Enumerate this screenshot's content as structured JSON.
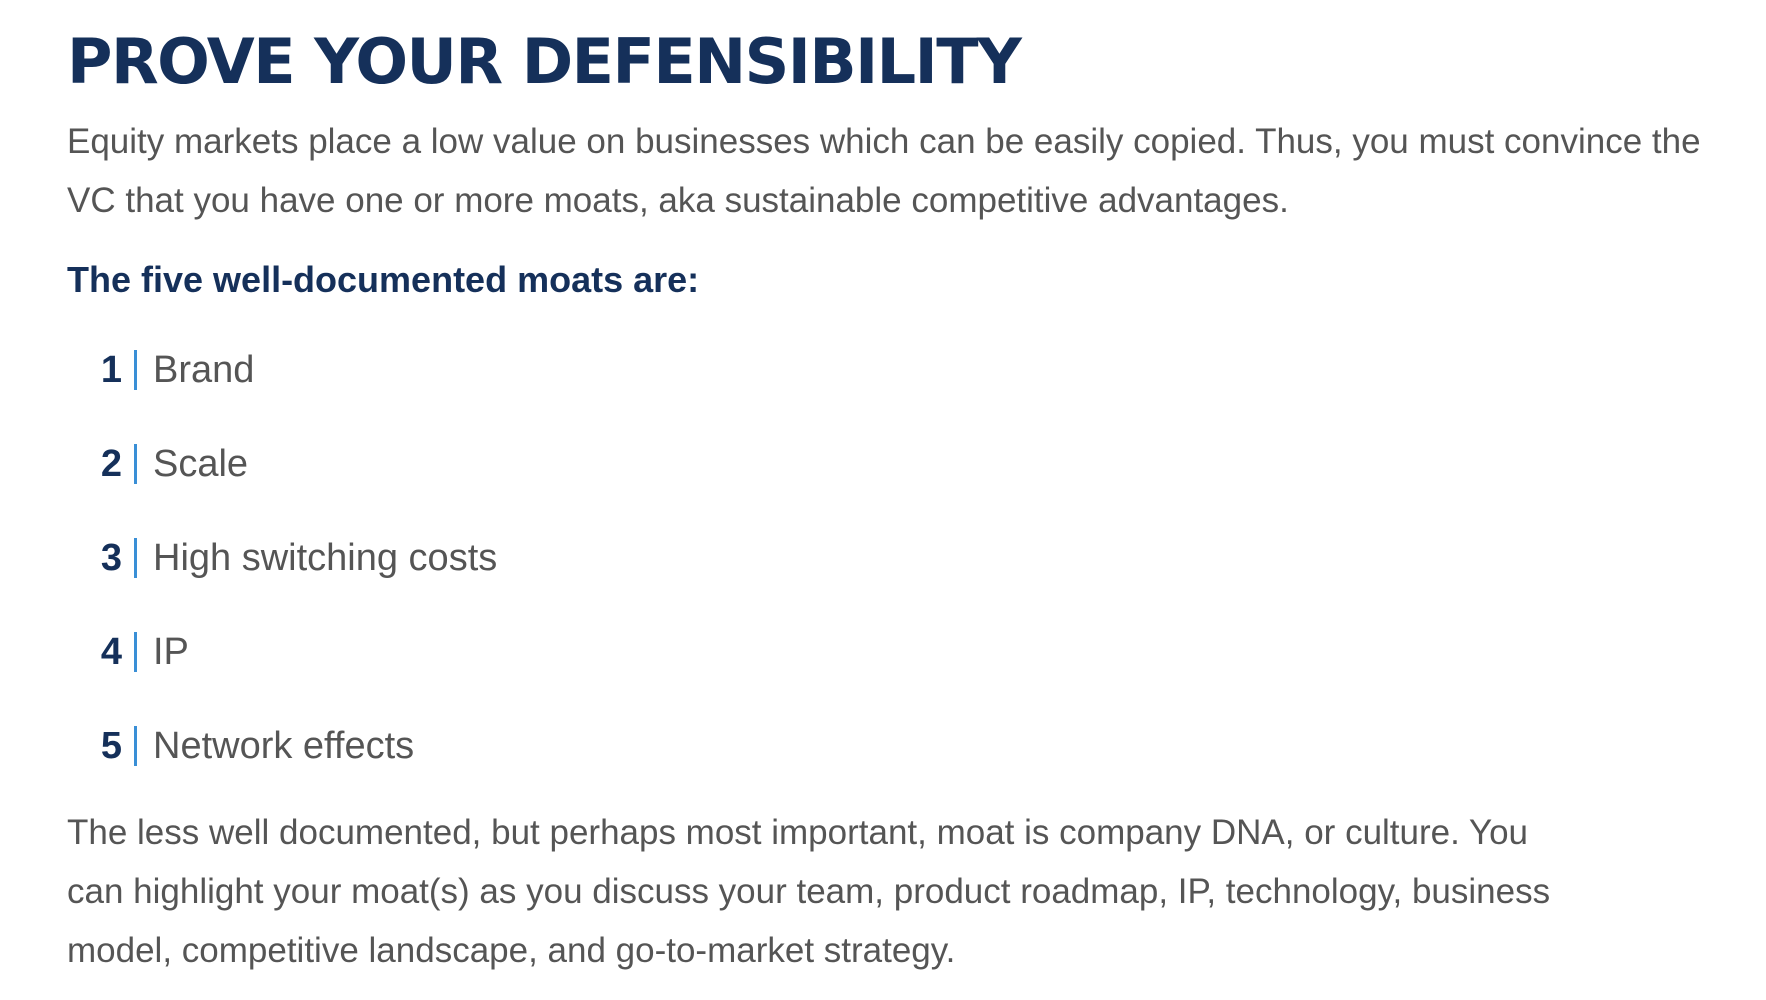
{
  "title": "PROVE YOUR DEFENSIBILITY",
  "intro": "Equity markets place a low value on businesses which can be easily copied. Thus, you must convince the VC that you have one or more moats, aka sustainable competitive advantages.",
  "subheading": "The five well-documented moats are:",
  "moats": [
    {
      "number": "1",
      "label": "Brand"
    },
    {
      "number": "2",
      "label": "Scale"
    },
    {
      "number": "3",
      "label": "High switching costs"
    },
    {
      "number": "4",
      "label": "IP"
    },
    {
      "number": "5",
      "label": "Network effects"
    }
  ],
  "outro": "The less well documented, but perhaps most important, moat is company DNA, or culture. You can highlight your moat(s) as you discuss your team, product roadmap, IP, technology, business model, competitive landscape, and go-to-market strategy.",
  "colors": {
    "heading": "#15305a",
    "body_text": "#555555",
    "separator": "#3a8fd6"
  }
}
